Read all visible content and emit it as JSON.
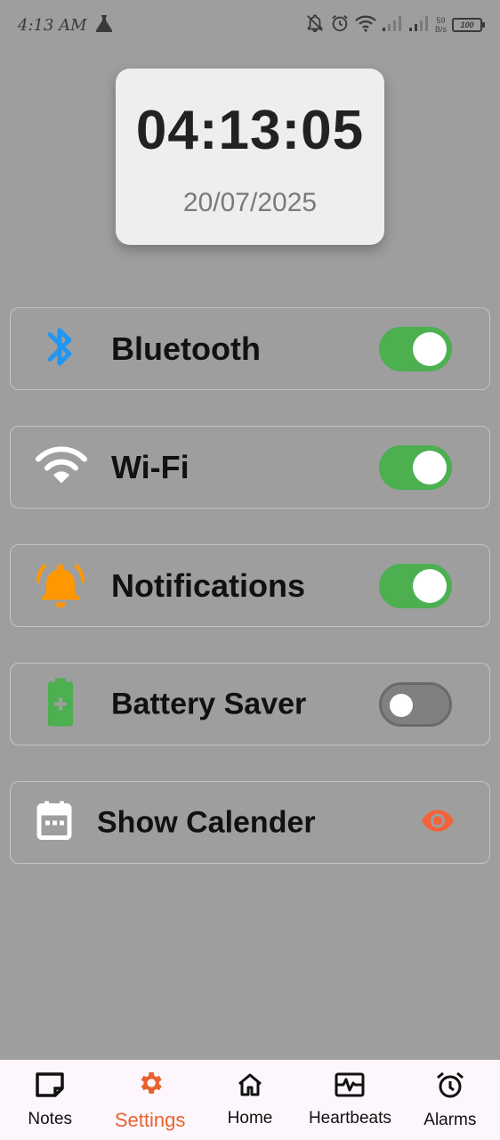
{
  "status_bar": {
    "time": "4:13 AM",
    "net_speed_value": "59",
    "net_speed_unit": "B/s",
    "battery": "100",
    "icons": [
      "flask-icon",
      "notifications-off-icon",
      "alarm-icon",
      "wifi-icon",
      "signal-icon",
      "signal-icon"
    ]
  },
  "clock": {
    "time": "04:13:05",
    "date": "20/07/2025"
  },
  "settings": [
    {
      "label": "Bluetooth",
      "icon": "bluetooth-icon",
      "icon_color": "#2196f3",
      "enabled": true
    },
    {
      "label": "Wi-Fi",
      "icon": "wifi-icon",
      "icon_color": "#ffffff",
      "enabled": true
    },
    {
      "label": "Notifications",
      "icon": "bell-ringing-icon",
      "icon_color": "#ff9800",
      "enabled": true
    },
    {
      "label": "Battery Saver",
      "icon": "battery-charging-icon",
      "icon_color": "#4caf50",
      "enabled": false
    },
    {
      "label": "Show Calender",
      "icon": "calendar-icon",
      "icon_color": "#ffffff",
      "action_icon": "eye-icon",
      "action_color": "#f4623a"
    }
  ],
  "colors": {
    "background": "#9e9e9e",
    "toggle_on": "#4caf50",
    "toggle_off": "#808080",
    "accent": "#e8622e",
    "nav_background": "#fdf7fd"
  },
  "bottom_nav": {
    "active": "Settings",
    "items": [
      {
        "label": "Notes",
        "icon": "note-icon"
      },
      {
        "label": "Settings",
        "icon": "gear-icon"
      },
      {
        "label": "Home",
        "icon": "home-icon"
      },
      {
        "label": "Heartbeats",
        "icon": "heartbeat-icon"
      },
      {
        "label": "Alarms",
        "icon": "alarm-clock-icon"
      }
    ]
  }
}
